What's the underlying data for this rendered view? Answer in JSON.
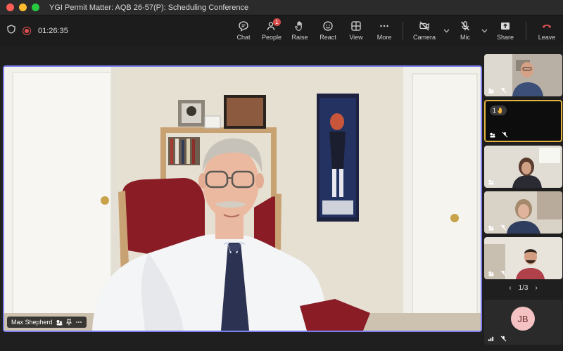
{
  "window": {
    "title": "YGI Permit Matter: AQB 26-57(P): Scheduling Conference"
  },
  "toolbar": {
    "timer": "01:26:35",
    "buttons": [
      {
        "label": "Chat",
        "icon": "chat-icon"
      },
      {
        "label": "People",
        "icon": "people-icon",
        "badge": "1"
      },
      {
        "label": "Raise",
        "icon": "raise-hand-icon"
      },
      {
        "label": "React",
        "icon": "react-icon"
      },
      {
        "label": "View",
        "icon": "view-icon"
      },
      {
        "label": "More",
        "icon": "more-icon"
      }
    ],
    "camera_label": "Camera",
    "mic_label": "Mic",
    "share_label": "Share",
    "leave_label": "Leave"
  },
  "main_video": {
    "speaker_name": "Max Shepherd"
  },
  "side_panel": {
    "raised_hand_count": "1",
    "pager": {
      "current": "1",
      "total": "3",
      "text": "1/3"
    },
    "avatar_initials": "JB"
  },
  "colors": {
    "accent": "#7c7ef0",
    "raised_hand_border": "#e3b341",
    "leave_red": "#e25555",
    "badge_red": "#d74b4b"
  }
}
